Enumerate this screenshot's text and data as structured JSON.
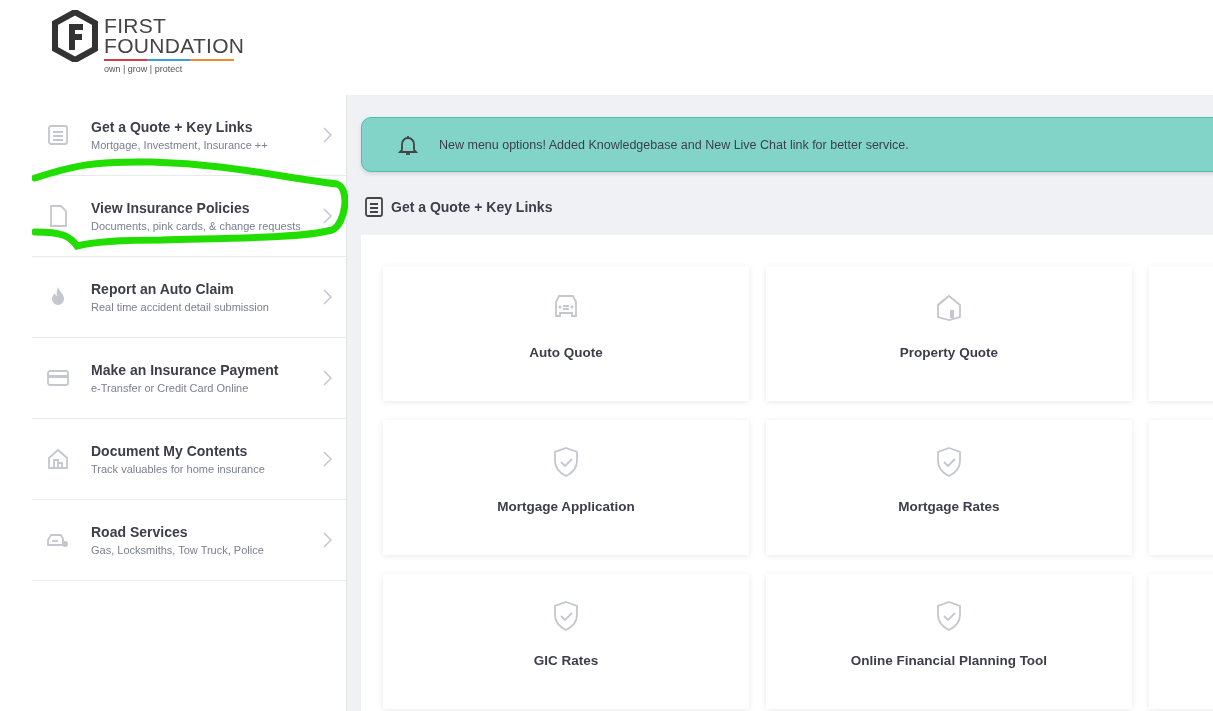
{
  "logo": {
    "line_1": "FIRST",
    "line_2": "FOUNDATION",
    "tagline": "own | grow | protect"
  },
  "sidebar": {
    "items": [
      {
        "title": "Get a Quote + Key Links",
        "subtitle": "Mortgage, Investment, Insurance ++",
        "circled": false
      },
      {
        "title": "View Insurance Policies",
        "subtitle": "Documents, pink cards, & change requests",
        "circled": true
      },
      {
        "title": "Report an Auto Claim",
        "subtitle": "Real time accident detail submission",
        "circled": false
      },
      {
        "title": "Make an Insurance Payment",
        "subtitle": "e-Transfer or Credit Card Online",
        "circled": false
      },
      {
        "title": "Document My Contents",
        "subtitle": "Track valuables for home insurance",
        "circled": false
      },
      {
        "title": "Road Services",
        "subtitle": "Gas, Locksmiths, Tow Truck, Police",
        "circled": false
      }
    ]
  },
  "banner": {
    "text": "New menu options! Added Knowledgebase and New Live Chat link for better service."
  },
  "section": {
    "title": "Get a Quote + Key Links"
  },
  "cards": [
    {
      "label": "Auto Quote"
    },
    {
      "label": "Property Quote"
    },
    {
      "label": "Mortgage Application"
    },
    {
      "label": "Mortgage Rates"
    },
    {
      "label": "GIC Rates"
    },
    {
      "label": "Online Financial Planning Tool"
    }
  ]
}
